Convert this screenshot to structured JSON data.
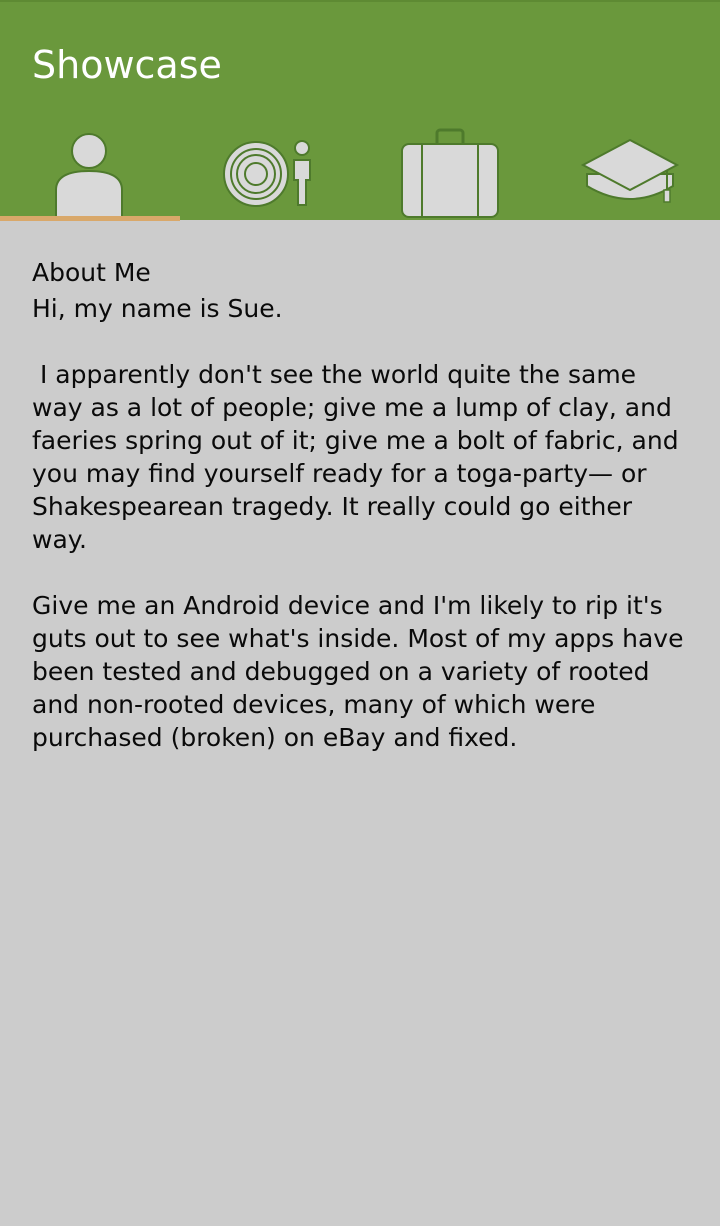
{
  "app": {
    "title": "Showcase",
    "colors": {
      "toolbar": "#6a983c",
      "background": "#cccccc",
      "tab_indicator": "#d9a86a",
      "icon_fill": "#d9d9d9",
      "icon_stroke": "#4e7a2c"
    }
  },
  "tabs": [
    {
      "name": "about",
      "icon": "person-icon",
      "selected": true
    },
    {
      "name": "interests",
      "icon": "target-person-icon",
      "selected": false
    },
    {
      "name": "work",
      "icon": "briefcase-icon",
      "selected": false
    },
    {
      "name": "education",
      "icon": "graduation-cap-icon",
      "selected": false
    }
  ],
  "about": {
    "heading": "About Me",
    "paragraphs": [
      "Hi, my name is Sue.",
      " I apparently don't see the world quite the same way as a lot of people; give me a lump of clay, and faeries spring out of it; give me a bolt of fabric, and you may find yourself ready for a toga-party— or Shakespearean tragedy. It really could go either way.",
      "Give me an Android device and I'm likely to rip it's guts out to see what's inside. Most of my apps have been tested and debugged on a variety of rooted and non-rooted devices, many of which were purchased (broken) on eBay and fixed."
    ]
  }
}
